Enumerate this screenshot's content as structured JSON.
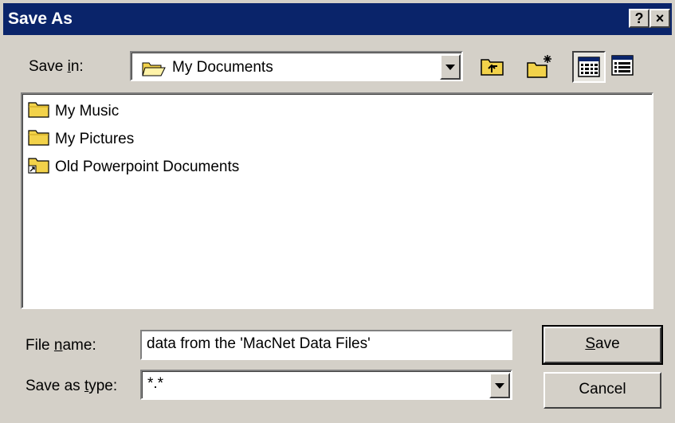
{
  "window": {
    "title": "Save As",
    "help_label": "?",
    "close_label": "×"
  },
  "save_in": {
    "label_prefix": "Save ",
    "label_accel": "i",
    "label_suffix": "n:",
    "value": "My Documents"
  },
  "files": [
    {
      "name": "My Music",
      "icon": "folder-icon"
    },
    {
      "name": "My Pictures",
      "icon": "folder-icon"
    },
    {
      "name": "Old Powerpoint Documents",
      "icon": "folder-shortcut-icon"
    }
  ],
  "file_name": {
    "label_prefix": "File ",
    "label_accel": "n",
    "label_suffix": "ame:",
    "value": "data from the 'MacNet Data Files'"
  },
  "save_as_type": {
    "label_prefix": "Save as ",
    "label_accel": "t",
    "label_suffix": "ype:",
    "value": "*.*"
  },
  "buttons": {
    "save_accel": "S",
    "save_rest": "ave",
    "cancel": "Cancel"
  },
  "colors": {
    "titlebar": "#0a246a",
    "face": "#d4d0c8",
    "folder": "#f2d24a"
  }
}
